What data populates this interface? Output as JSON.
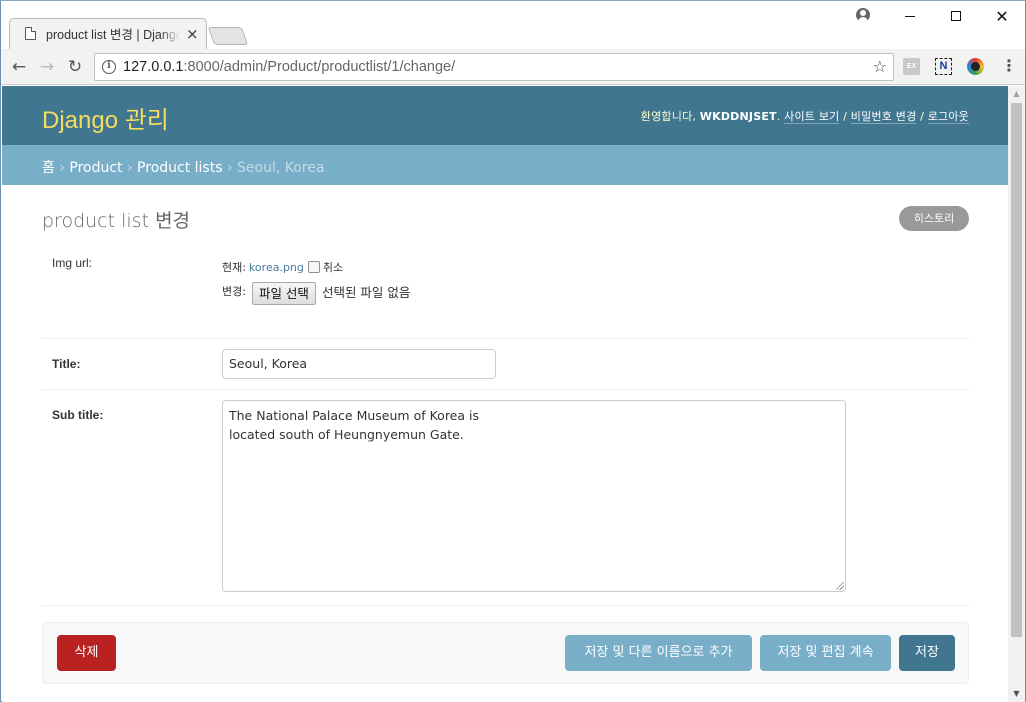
{
  "browser": {
    "tab_title": "product list 변경 | Django",
    "tab_close": "×",
    "url_host": "127.0.0.1",
    "url_rest": ":8000/admin/Product/productlist/1/change/",
    "ext_ex_label": "EX",
    "ext_n_label": "N"
  },
  "header": {
    "branding": "Django 관리",
    "welcome": "환영합니다, ",
    "username": "WKDDNJSET",
    "welcome_end": ". ",
    "view_site": "사이트 보기",
    "sep1": " / ",
    "change_password": "비밀번호 변경",
    "sep2": " / ",
    "logout": "로그아웃"
  },
  "breadcrumbs": {
    "home": "홈",
    "app": "Product",
    "model": "Product lists",
    "current": "Seoul, Korea",
    "separator": " › "
  },
  "content": {
    "title": "product list 변경",
    "history_button": "히스토리"
  },
  "form": {
    "img_url": {
      "label": "Img url:",
      "current_label": "현재:",
      "current_file": "korea.png",
      "clear_label": "취소",
      "change_label": "변경:",
      "choose_file_button": "파일 선택",
      "no_file_text": "선택된 파일 없음"
    },
    "title": {
      "label": "Title:",
      "value": "Seoul, Korea"
    },
    "sub_title": {
      "label": "Sub title:",
      "value": "The National Palace Museum of Korea is\nlocated south of Heungnyemun Gate."
    }
  },
  "actions": {
    "delete": "삭제",
    "save_add_another": "저장 및 다른 이름으로 추가",
    "save_continue": "저장 및 편집 계속",
    "save": "저장"
  },
  "colors": {
    "header_bg": "#417690",
    "breadcrumbs_bg": "#79aec8",
    "branding": "#f5dd5d",
    "delete_bg": "#ba2121",
    "save_bg": "#417690",
    "secondary_btn_bg": "#79aec8"
  }
}
